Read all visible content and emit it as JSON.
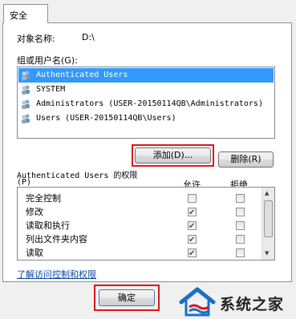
{
  "tab": {
    "label": "安全"
  },
  "object": {
    "label": "对象名称:",
    "value": "D:\\"
  },
  "groups": {
    "label": "组或用户名(G):",
    "items": [
      {
        "label": "Authenticated Users",
        "selected": true
      },
      {
        "label": "SYSTEM",
        "selected": false
      },
      {
        "label": "Administrators (USER-20150114QB\\Administrators)",
        "selected": false
      },
      {
        "label": "Users (USER-20150114QB\\Users)",
        "selected": false
      }
    ]
  },
  "buttons": {
    "add": "添加(D)...",
    "remove": "删除(R)",
    "ok": "确定"
  },
  "permissions": {
    "title": "Authenticated Users 的权限",
    "hotkey": "(P)",
    "allow_header": "允许",
    "deny_header": "拒绝",
    "rows": [
      {
        "label": "完全控制",
        "allow": false,
        "deny": false
      },
      {
        "label": "修改",
        "allow": true,
        "deny": false
      },
      {
        "label": "读取和执行",
        "allow": true,
        "deny": false
      },
      {
        "label": "列出文件夹内容",
        "allow": true,
        "deny": false
      },
      {
        "label": "读取",
        "allow": true,
        "deny": false
      }
    ]
  },
  "link": {
    "label": "了解访问控制和权限"
  },
  "watermark": {
    "text": "系统之家"
  },
  "colors": {
    "selection": "#3399ff",
    "highlight_border": "#e0161b",
    "link": "#0a47a8"
  }
}
